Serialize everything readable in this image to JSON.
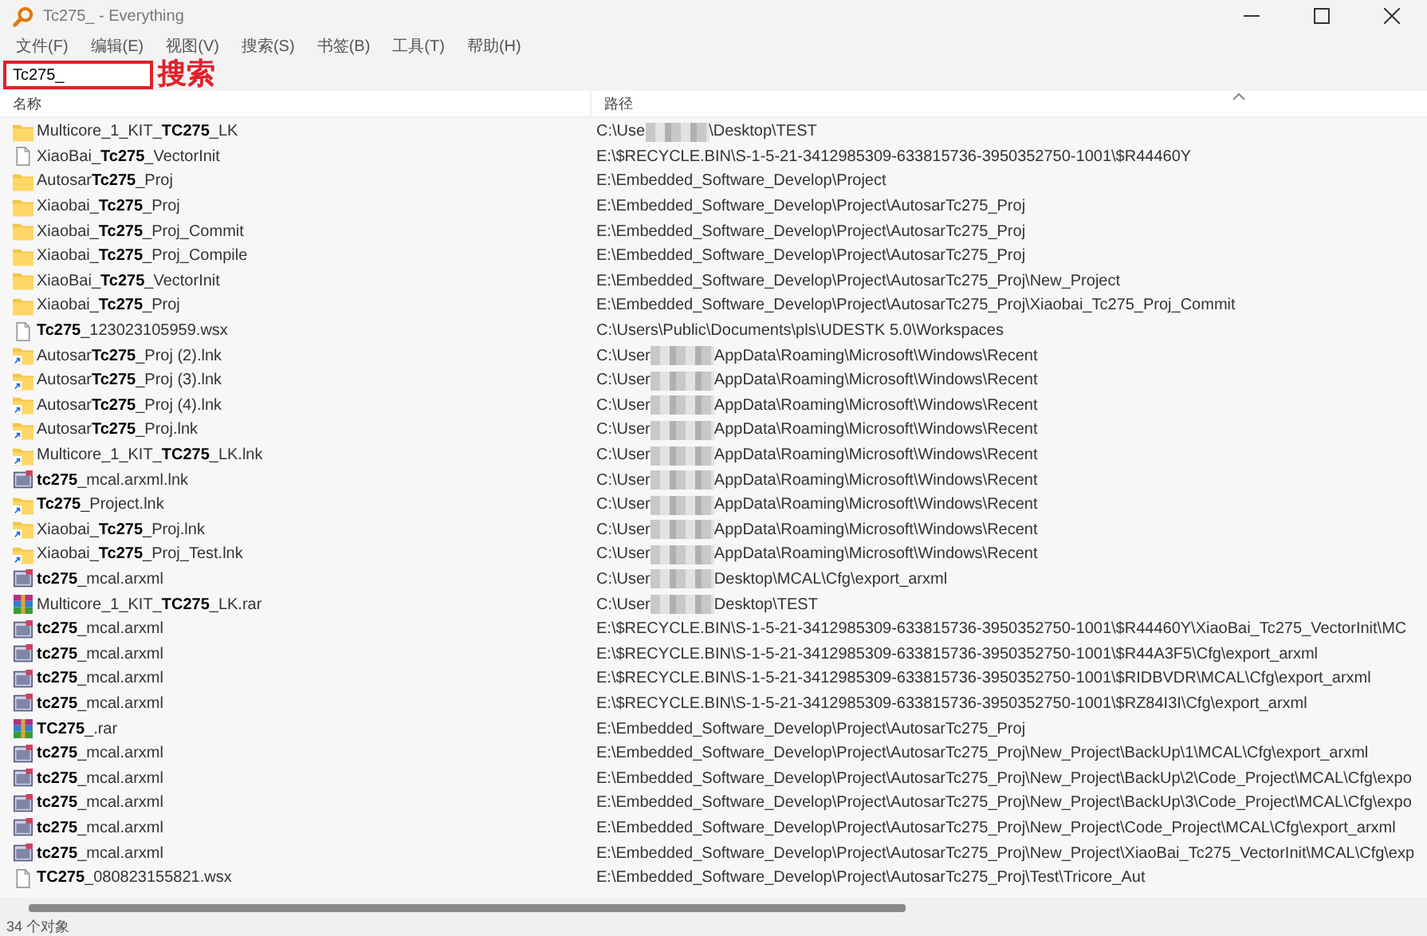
{
  "window": {
    "title": "Tc275_ - Everything"
  },
  "menu": [
    "文件(F)",
    "编辑(E)",
    "视图(V)",
    "搜索(S)",
    "书签(B)",
    "工具(T)",
    "帮助(H)"
  ],
  "search": {
    "value": "Tc275_",
    "annotation": "搜索"
  },
  "table": {
    "columns": [
      {
        "label": "名称",
        "sorted": false
      },
      {
        "label": "路径",
        "sorted": true
      }
    ],
    "rows": [
      {
        "kind": "folder",
        "name": "Multicore_1_KIT_**TC275**_LK",
        "path": "C:\\Use",
        "path_tail": "\\Desktop\\TEST"
      },
      {
        "kind": "file",
        "name": "XiaoBai_**Tc275**_VectorInit",
        "path": "E:\\$RECYCLE.BIN\\S-1-5-21-3412985309-633815736-3950352750-1001\\$R44460Y"
      },
      {
        "kind": "folder",
        "name": "Autosar**Tc275**_Proj",
        "path": "E:\\Embedded_Software_Develop\\Project"
      },
      {
        "kind": "folder",
        "name": "Xiaobai_**Tc275**_Proj",
        "path": "E:\\Embedded_Software_Develop\\Project\\AutosarTc275_Proj"
      },
      {
        "kind": "folder",
        "name": "Xiaobai_**Tc275**_Proj_Commit",
        "path": "E:\\Embedded_Software_Develop\\Project\\AutosarTc275_Proj"
      },
      {
        "kind": "folder",
        "name": "Xiaobai_**Tc275**_Proj_Compile",
        "path": "E:\\Embedded_Software_Develop\\Project\\AutosarTc275_Proj"
      },
      {
        "kind": "folder",
        "name": "XiaoBai_**Tc275**_VectorInit",
        "path": "E:\\Embedded_Software_Develop\\Project\\AutosarTc275_Proj\\New_Project"
      },
      {
        "kind": "folder",
        "name": "Xiaobai_**Tc275**_Proj",
        "path": "E:\\Embedded_Software_Develop\\Project\\AutosarTc275_Proj\\Xiaobai_Tc275_Proj_Commit"
      },
      {
        "kind": "file",
        "name": "**Tc275**_123023105959.wsx",
        "path": "C:\\Users\\Public\\Documents\\pls\\UDESTK 5.0\\Workspaces"
      },
      {
        "kind": "shortcut",
        "name": "Autosar**Tc275**_Proj (2).lnk",
        "path": "C:\\User",
        "path_tail": "AppData\\Roaming\\Microsoft\\Windows\\Recent"
      },
      {
        "kind": "shortcut",
        "name": "Autosar**Tc275**_Proj (3).lnk",
        "path": "C:\\User",
        "path_tail": "AppData\\Roaming\\Microsoft\\Windows\\Recent"
      },
      {
        "kind": "shortcut",
        "name": "Autosar**Tc275**_Proj (4).lnk",
        "path": "C:\\User",
        "path_tail": "AppData\\Roaming\\Microsoft\\Windows\\Recent"
      },
      {
        "kind": "shortcut",
        "name": "Autosar**Tc275**_Proj.lnk",
        "path": "C:\\User",
        "path_tail": "AppData\\Roaming\\Microsoft\\Windows\\Recent"
      },
      {
        "kind": "shortcut",
        "name": "Multicore_1_KIT_**TC275**_LK.lnk",
        "path": "C:\\User",
        "path_tail": "AppData\\Roaming\\Microsoft\\Windows\\Recent"
      },
      {
        "kind": "arxml",
        "name": "**tc275**_mcal.arxml.lnk",
        "path": "C:\\User",
        "path_tail": "AppData\\Roaming\\Microsoft\\Windows\\Recent"
      },
      {
        "kind": "shortcut",
        "name": "**Tc275**_Project.lnk",
        "path": "C:\\User",
        "path_tail": "AppData\\Roaming\\Microsoft\\Windows\\Recent"
      },
      {
        "kind": "shortcut",
        "name": "Xiaobai_**Tc275**_Proj.lnk",
        "path": "C:\\User",
        "path_tail": "AppData\\Roaming\\Microsoft\\Windows\\Recent"
      },
      {
        "kind": "shortcut",
        "name": "Xiaobai_**Tc275**_Proj_Test.lnk",
        "path": "C:\\User",
        "path_tail": "AppData\\Roaming\\Microsoft\\Windows\\Recent"
      },
      {
        "kind": "arxml",
        "name": "**tc275**_mcal.arxml",
        "path": "C:\\User",
        "path_tail": "Desktop\\MCAL\\Cfg\\export_arxml"
      },
      {
        "kind": "rar",
        "name": "Multicore_1_KIT_**TC275**_LK.rar",
        "path": "C:\\User",
        "path_tail": "Desktop\\TEST"
      },
      {
        "kind": "arxml",
        "name": "**tc275**_mcal.arxml",
        "path": "E:\\$RECYCLE.BIN\\S-1-5-21-3412985309-633815736-3950352750-1001\\$R44460Y\\XiaoBai_Tc275_VectorInit\\MC"
      },
      {
        "kind": "arxml",
        "name": "**tc275**_mcal.arxml",
        "path": "E:\\$RECYCLE.BIN\\S-1-5-21-3412985309-633815736-3950352750-1001\\$R44A3F5\\Cfg\\export_arxml"
      },
      {
        "kind": "arxml",
        "name": "**tc275**_mcal.arxml",
        "path": "E:\\$RECYCLE.BIN\\S-1-5-21-3412985309-633815736-3950352750-1001\\$RIDBVDR\\MCAL\\Cfg\\export_arxml"
      },
      {
        "kind": "arxml",
        "name": "**tc275**_mcal.arxml",
        "path": "E:\\$RECYCLE.BIN\\S-1-5-21-3412985309-633815736-3950352750-1001\\$RZ84I3I\\Cfg\\export_arxml"
      },
      {
        "kind": "rar",
        "name": "**TC275**_.rar",
        "path": "E:\\Embedded_Software_Develop\\Project\\AutosarTc275_Proj"
      },
      {
        "kind": "arxml",
        "name": "**tc275**_mcal.arxml",
        "path": "E:\\Embedded_Software_Develop\\Project\\AutosarTc275_Proj\\New_Project\\BackUp\\1\\MCAL\\Cfg\\export_arxml"
      },
      {
        "kind": "arxml",
        "name": "**tc275**_mcal.arxml",
        "path": "E:\\Embedded_Software_Develop\\Project\\AutosarTc275_Proj\\New_Project\\BackUp\\2\\Code_Project\\MCAL\\Cfg\\expo"
      },
      {
        "kind": "arxml",
        "name": "**tc275**_mcal.arxml",
        "path": "E:\\Embedded_Software_Develop\\Project\\AutosarTc275_Proj\\New_Project\\BackUp\\3\\Code_Project\\MCAL\\Cfg\\expo"
      },
      {
        "kind": "arxml",
        "name": "**tc275**_mcal.arxml",
        "path": "E:\\Embedded_Software_Develop\\Project\\AutosarTc275_Proj\\New_Project\\Code_Project\\MCAL\\Cfg\\export_arxml"
      },
      {
        "kind": "arxml",
        "name": "**tc275**_mcal.arxml",
        "path": "E:\\Embedded_Software_Develop\\Project\\AutosarTc275_Proj\\New_Project\\XiaoBai_Tc275_VectorInit\\MCAL\\Cfg\\exp"
      },
      {
        "kind": "file",
        "name": "**TC275**_080823155821.wsx",
        "path": "E:\\Embedded_Software_Develop\\Project\\AutosarTc275_Proj\\Test\\Tricore_Aut"
      }
    ]
  },
  "status_bar": "34 个对象"
}
